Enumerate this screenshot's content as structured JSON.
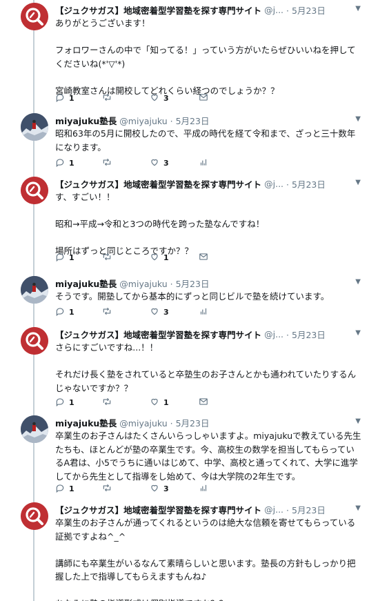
{
  "tweets": [
    {
      "avatar": "jukusagasu-logo",
      "name": "【ジュクサガス】地域密着型学習塾を探す専門サイト",
      "handle": "@j...",
      "date": "5月23日",
      "lines": [
        "ありがとうございます！",
        "",
        "フォロワーさんの中で「知ってる！」っていう方がいたらぜひいいねを押して",
        "くださいね(*'▽'*)",
        "",
        "宮崎教室さんは開校してどれくらい経つのでしょうか？？"
      ],
      "reply": "1",
      "retweet": "",
      "like": "3",
      "extra_icon": "mail-icon"
    },
    {
      "avatar": "miyajuku-photo",
      "name": "miyajuku塾長",
      "handle": "@miyajuku · 5月23日",
      "date": "",
      "lines": [
        "昭和63年の5月に開校したので、平成の時代を経て令和まで、ざっと三十数年",
        "になります。"
      ],
      "reply": "1",
      "retweet": "",
      "like": "3",
      "extra_icon": "analytics-icon"
    },
    {
      "avatar": "jukusagasu-logo",
      "name": "【ジュクサガス】地域密着型学習塾を探す専門サイト",
      "handle": "@j...",
      "date": "5月23日",
      "lines": [
        "す、すごい！！",
        "",
        "昭和→平成→令和と3つの時代を跨った塾なんですね！",
        "",
        "場所はずっと同じところですか？？"
      ],
      "reply": "1",
      "retweet": "",
      "like": "1",
      "extra_icon": "mail-icon"
    },
    {
      "avatar": "miyajuku-photo",
      "name": "miyajuku塾長",
      "handle": "@miyajuku · 5月23日",
      "date": "",
      "lines": [
        "そうです。開塾してから基本的にずっと同じビルで塾を続けています。"
      ],
      "reply": "1",
      "retweet": "",
      "like": "3",
      "extra_icon": "analytics-icon"
    },
    {
      "avatar": "jukusagasu-logo",
      "name": "【ジュクサガス】地域密着型学習塾を探す専門サイト",
      "handle": "@j...",
      "date": "5月23日",
      "lines": [
        "さらにすごいですね...！！",
        "",
        "それだけ長く塾をされていると卒塾生のお子さんとかも通われていたりするん",
        "じゃないですか？？"
      ],
      "reply": "1",
      "retweet": "",
      "like": "1",
      "extra_icon": "mail-icon"
    },
    {
      "avatar": "miyajuku-photo",
      "name": "miyajuku塾長",
      "handle": "@miyajuku · 5月23日",
      "date": "",
      "lines": [
        "卒業生のお子さんはたくさんいらっしゃいますよ。miyajukuで教えている先生",
        "たちも、ほとんどが塾の卒業生です。今、高校生の数学を担当してもらってい",
        "るA君は、小5でうちに通いはじめて、中学、高校と通ってくれて、大学に進学",
        "してから先生として指導をし始めて、今は大学院の2年生です。"
      ],
      "reply": "1",
      "retweet": "",
      "like": "3",
      "extra_icon": "analytics-icon"
    },
    {
      "avatar": "jukusagasu-logo",
      "name": "【ジュクサガス】地域密着型学習塾を探す専門サイト",
      "handle": "@j...",
      "date": "5月23日",
      "lines": [
        "卒業生のお子さんが通ってくれるというのは絶大な信頼を寄せてもらっている",
        "証拠ですよね^_^",
        "",
        "講師にも卒業生がいるなんて素晴らしいと思います。塾長の方針もしっかり把",
        "握した上で指導してもらえますもんね♪",
        "",
        "ちなみに塾の指導形式は個別指導ですか？？"
      ],
      "reply": "",
      "retweet": "",
      "like": "",
      "extra_icon": ""
    }
  ]
}
